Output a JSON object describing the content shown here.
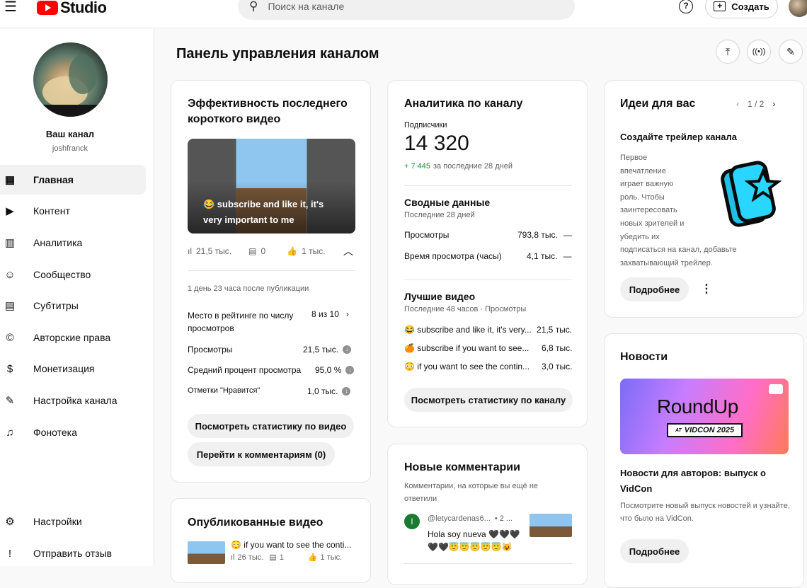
{
  "header": {
    "logo_text": "Studio",
    "search_placeholder": "Поиск на канале",
    "create_label": "Создать"
  },
  "sidebar": {
    "channel_name": "Ваш канал",
    "channel_handle": "joshfranck",
    "items": [
      {
        "label": "Главная",
        "icon": "dashboard-icon"
      },
      {
        "label": "Контент",
        "icon": "content-icon"
      },
      {
        "label": "Аналитика",
        "icon": "analytics-icon"
      },
      {
        "label": "Сообщество",
        "icon": "community-icon"
      },
      {
        "label": "Субтитры",
        "icon": "subtitles-icon"
      },
      {
        "label": "Авторские права",
        "icon": "copyright-icon"
      },
      {
        "label": "Монетизация",
        "icon": "monetization-icon"
      },
      {
        "label": "Настройка канала",
        "icon": "customization-icon"
      },
      {
        "label": "Фонотека",
        "icon": "audio-library-icon"
      }
    ],
    "settings_label": "Настройки",
    "feedback_label": "Отправить отзыв"
  },
  "main": {
    "title": "Панель управления каналом"
  },
  "short_card": {
    "title": "Эффективность последнего короткого видео",
    "thumb_caption": "😂 subscribe and like it, it's very important to me",
    "views_stat": "21,5 тыс.",
    "comments_stat": "0",
    "likes_stat": "1 тыс.",
    "since_publish": "1 день 23 часа после публикации",
    "rank_label": "Место в рейтинге по числу просмотров",
    "rank_value": "8 из 10",
    "views_label": "Просмотры",
    "views_value": "21,5 тыс.",
    "avg_label": "Средний процент просмотра",
    "avg_value": "95,0 %",
    "likes_label": "Отметки \"Нравится\"",
    "likes_value": "1,0 тыс.",
    "stats_button": "Посмотреть статистику по видео",
    "comments_button": "Перейти к комментариям (0)"
  },
  "published_card": {
    "title": "Опубликованные видео",
    "video_title": "😳 if you want to see the conti...",
    "views": "26 тыс.",
    "comments": "1",
    "likes": "1 тыс."
  },
  "analytics_card": {
    "title": "Аналитика по каналу",
    "subs_label": "Подписчики",
    "subs_value": "14 320",
    "subs_delta": "+ 7 445",
    "subs_delta_period": "за последние 28 дней",
    "summary_title": "Сводные данные",
    "summary_period": "Последние 28 дней",
    "views_label": "Просмотры",
    "views_value": "793,8 тыс.",
    "views_trend": "—",
    "watch_label": "Время просмотра (часы)",
    "watch_value": "4,1 тыс.",
    "watch_trend": "—",
    "top_title": "Лучшие видео",
    "top_period": "Последние 48 часов · Просмотры",
    "top_videos": [
      {
        "title": "😂 subscribe and like it, it's very...",
        "views": "21,5 тыс."
      },
      {
        "title": "🍊 subscribe if you want to see...",
        "views": "6,8 тыс."
      },
      {
        "title": "😳 if you want to see the contin...",
        "views": "3,0 тыс."
      }
    ],
    "button": "Посмотреть статистику по каналу"
  },
  "comments_card": {
    "title": "Новые комментарии",
    "subtitle": "Комментарии, на которые вы ещё не ответили",
    "author": "@letycardenas6...",
    "time": "• 2 ...",
    "text": "Hola soy nueva 🖤🖤🖤🖤🖤😇😇😇😇😇😺",
    "avatar_letter": "l"
  },
  "ideas_card": {
    "title": "Идеи для вас",
    "pager": "1 / 2",
    "subtitle": "Создайте трейлер канала",
    "body_lines": [
      "Первое",
      "впечатление",
      "играет важную",
      "роль. Чтобы",
      "заинтересовать",
      "новых зрителей и",
      "убедить их"
    ],
    "body_tail": "подписаться на канал, добавьте захватывающий трейлер.",
    "button": "Подробнее"
  },
  "news_card": {
    "title": "Новости",
    "banner_main": "RoundUp",
    "banner_at": "AT",
    "banner_event": "VIDCON 2025",
    "headline": "Новости для авторов: выпуск о VidCon",
    "body": "Посмотрите новый выпуск новостей и узнайте, что было на VidCon.",
    "button": "Подробнее"
  }
}
